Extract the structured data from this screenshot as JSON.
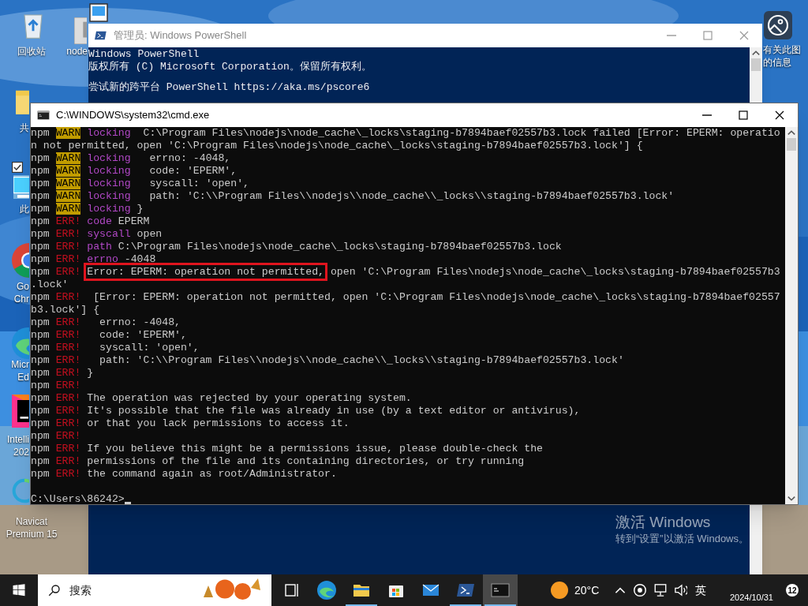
{
  "desktop_icons": [
    {
      "kind": "recycle",
      "selected": false,
      "lines": [
        "回收站"
      ]
    },
    {
      "kind": "app",
      "selected": false,
      "lines": [
        "node"
      ]
    },
    {
      "kind": "screen",
      "selected": false
    },
    {
      "kind": "folder",
      "selected": false,
      "lines": [
        "共"
      ]
    },
    {
      "kind": "pc",
      "selected": true,
      "lines": [
        "此"
      ]
    },
    {
      "kind": "chrome",
      "selected": false,
      "lines": [
        "Go",
        "Chr"
      ]
    },
    {
      "kind": "edge",
      "selected": false,
      "lines": [
        "Micr",
        "Ed"
      ]
    },
    {
      "kind": "intellij",
      "selected": false,
      "lines": [
        "Intelli",
        "202"
      ]
    },
    {
      "kind": "navicat",
      "selected": false,
      "lines": [
        "Navicat",
        "Premium 15"
      ]
    },
    {
      "selected": false,
      "lines": [
        "有关此图",
        "的信息"
      ]
    }
  ],
  "powershell": {
    "title": "管理员: Windows PowerShell",
    "paragraphs": [
      [
        "Windows PowerShell",
        "版权所有 (C) Microsoft Corporation。保留所有权利。"
      ],
      [
        "尝试新的跨平台 PowerShell https://aka.ms/pscore6"
      ]
    ],
    "activation": [
      "激活 Windows",
      "转到“设置”以激活 Windows。"
    ]
  },
  "cmd": {
    "title": "C:\\WINDOWS\\system32\\cmd.exe",
    "lines": [
      {
        "kind": "warn",
        "prefix": "npm",
        "tag": "WARN",
        "label": "locking",
        "text": " C:\\Program Files\\nodejs\\node_cache\\_locks\\staging-b7894baef02557b3.lock failed [Error: EPERM: operatio"
      },
      {
        "kind": "plain",
        "text": "n not permitted, open 'C:\\Program Files\\nodejs\\node_cache\\_locks\\staging-b7894baef02557b3.lock'] {"
      },
      {
        "kind": "warn",
        "prefix": "npm",
        "tag": "WARN",
        "label": "locking",
        "text": "  errno: -4048,"
      },
      {
        "kind": "warn",
        "prefix": "npm",
        "tag": "WARN",
        "label": "locking",
        "text": "  code: 'EPERM',"
      },
      {
        "kind": "warn",
        "prefix": "npm",
        "tag": "WARN",
        "label": "locking",
        "text": "  syscall: 'open',"
      },
      {
        "kind": "warn",
        "prefix": "npm",
        "tag": "WARN",
        "label": "locking",
        "text": "  path: 'C:\\\\Program Files\\\\nodejs\\\\node_cache\\\\_locks\\\\staging-b7894baef02557b3.lock'"
      },
      {
        "kind": "warn",
        "prefix": "npm",
        "tag": "WARN",
        "label": "locking",
        "text": "}"
      },
      {
        "kind": "err",
        "prefix": "npm",
        "tag": "ERR!",
        "label": "code",
        "text": "EPERM"
      },
      {
        "kind": "err",
        "prefix": "npm",
        "tag": "ERR!",
        "label": "syscall",
        "text": "open"
      },
      {
        "kind": "err",
        "prefix": "npm",
        "tag": "ERR!",
        "label": "path",
        "text": "C:\\Program Files\\nodejs\\node_cache\\_locks\\staging-b7894baef02557b3.lock"
      },
      {
        "kind": "err",
        "prefix": "npm",
        "tag": "ERR!",
        "label": "errno",
        "text": "-4048"
      },
      {
        "kind": "err",
        "prefix": "npm",
        "tag": "ERR!",
        "highlight": "Error: EPERM: operation not permitted,",
        "text": " open 'C:\\Program Files\\nodejs\\node_cache\\_locks\\staging-b7894baef02557b3"
      },
      {
        "kind": "plain",
        "text": ".lock'"
      },
      {
        "kind": "err",
        "prefix": "npm",
        "tag": "ERR!",
        "text": " [Error: EPERM: operation not permitted, open 'C:\\Program Files\\nodejs\\node_cache\\_locks\\staging-b7894baef02557"
      },
      {
        "kind": "plain",
        "text": "b3.lock'] {"
      },
      {
        "kind": "err",
        "prefix": "npm",
        "tag": "ERR!",
        "text": "  errno: -4048,"
      },
      {
        "kind": "err",
        "prefix": "npm",
        "tag": "ERR!",
        "text": "  code: 'EPERM',"
      },
      {
        "kind": "err",
        "prefix": "npm",
        "tag": "ERR!",
        "text": "  syscall: 'open',"
      },
      {
        "kind": "err",
        "prefix": "npm",
        "tag": "ERR!",
        "text": "  path: 'C:\\\\Program Files\\\\nodejs\\\\node_cache\\\\_locks\\\\staging-b7894baef02557b3.lock'"
      },
      {
        "kind": "err",
        "prefix": "npm",
        "tag": "ERR!",
        "text": "}"
      },
      {
        "kind": "err",
        "prefix": "npm",
        "tag": "ERR!"
      },
      {
        "kind": "err",
        "prefix": "npm",
        "tag": "ERR!",
        "text": "The operation was rejected by your operating system."
      },
      {
        "kind": "err",
        "prefix": "npm",
        "tag": "ERR!",
        "text": "It's possible that the file was already in use (by a text editor or antivirus),"
      },
      {
        "kind": "err",
        "prefix": "npm",
        "tag": "ERR!",
        "text": "or that you lack permissions to access it."
      },
      {
        "kind": "err",
        "prefix": "npm",
        "tag": "ERR!"
      },
      {
        "kind": "err",
        "prefix": "npm",
        "tag": "ERR!",
        "text": "If you believe this might be a permissions issue, please double-check the"
      },
      {
        "kind": "err",
        "prefix": "npm",
        "tag": "ERR!",
        "text": "permissions of the file and its containing directories, or try running"
      },
      {
        "kind": "err",
        "prefix": "npm",
        "tag": "ERR!",
        "text": "the command again as root/Administrator."
      },
      {
        "kind": "blank"
      },
      {
        "kind": "prompt",
        "text": "C:\\Users\\86242>"
      }
    ]
  },
  "taskbar": {
    "search": {
      "placeholder": "搜索"
    },
    "apps": [
      {
        "kind": "taskview",
        "running": false,
        "selected": false
      },
      {
        "kind": "edge",
        "running": false,
        "selected": false
      },
      {
        "kind": "files",
        "running": true,
        "selected": false
      },
      {
        "kind": "store",
        "running": false,
        "selected": false
      },
      {
        "kind": "mail",
        "running": false,
        "selected": false
      },
      {
        "kind": "powershell",
        "running": true,
        "selected": false
      },
      {
        "kind": "cmd",
        "running": true,
        "selected": true
      }
    ],
    "weather": "20°C",
    "language": "英",
    "date": "2024/10/31",
    "notifications": "12"
  }
}
